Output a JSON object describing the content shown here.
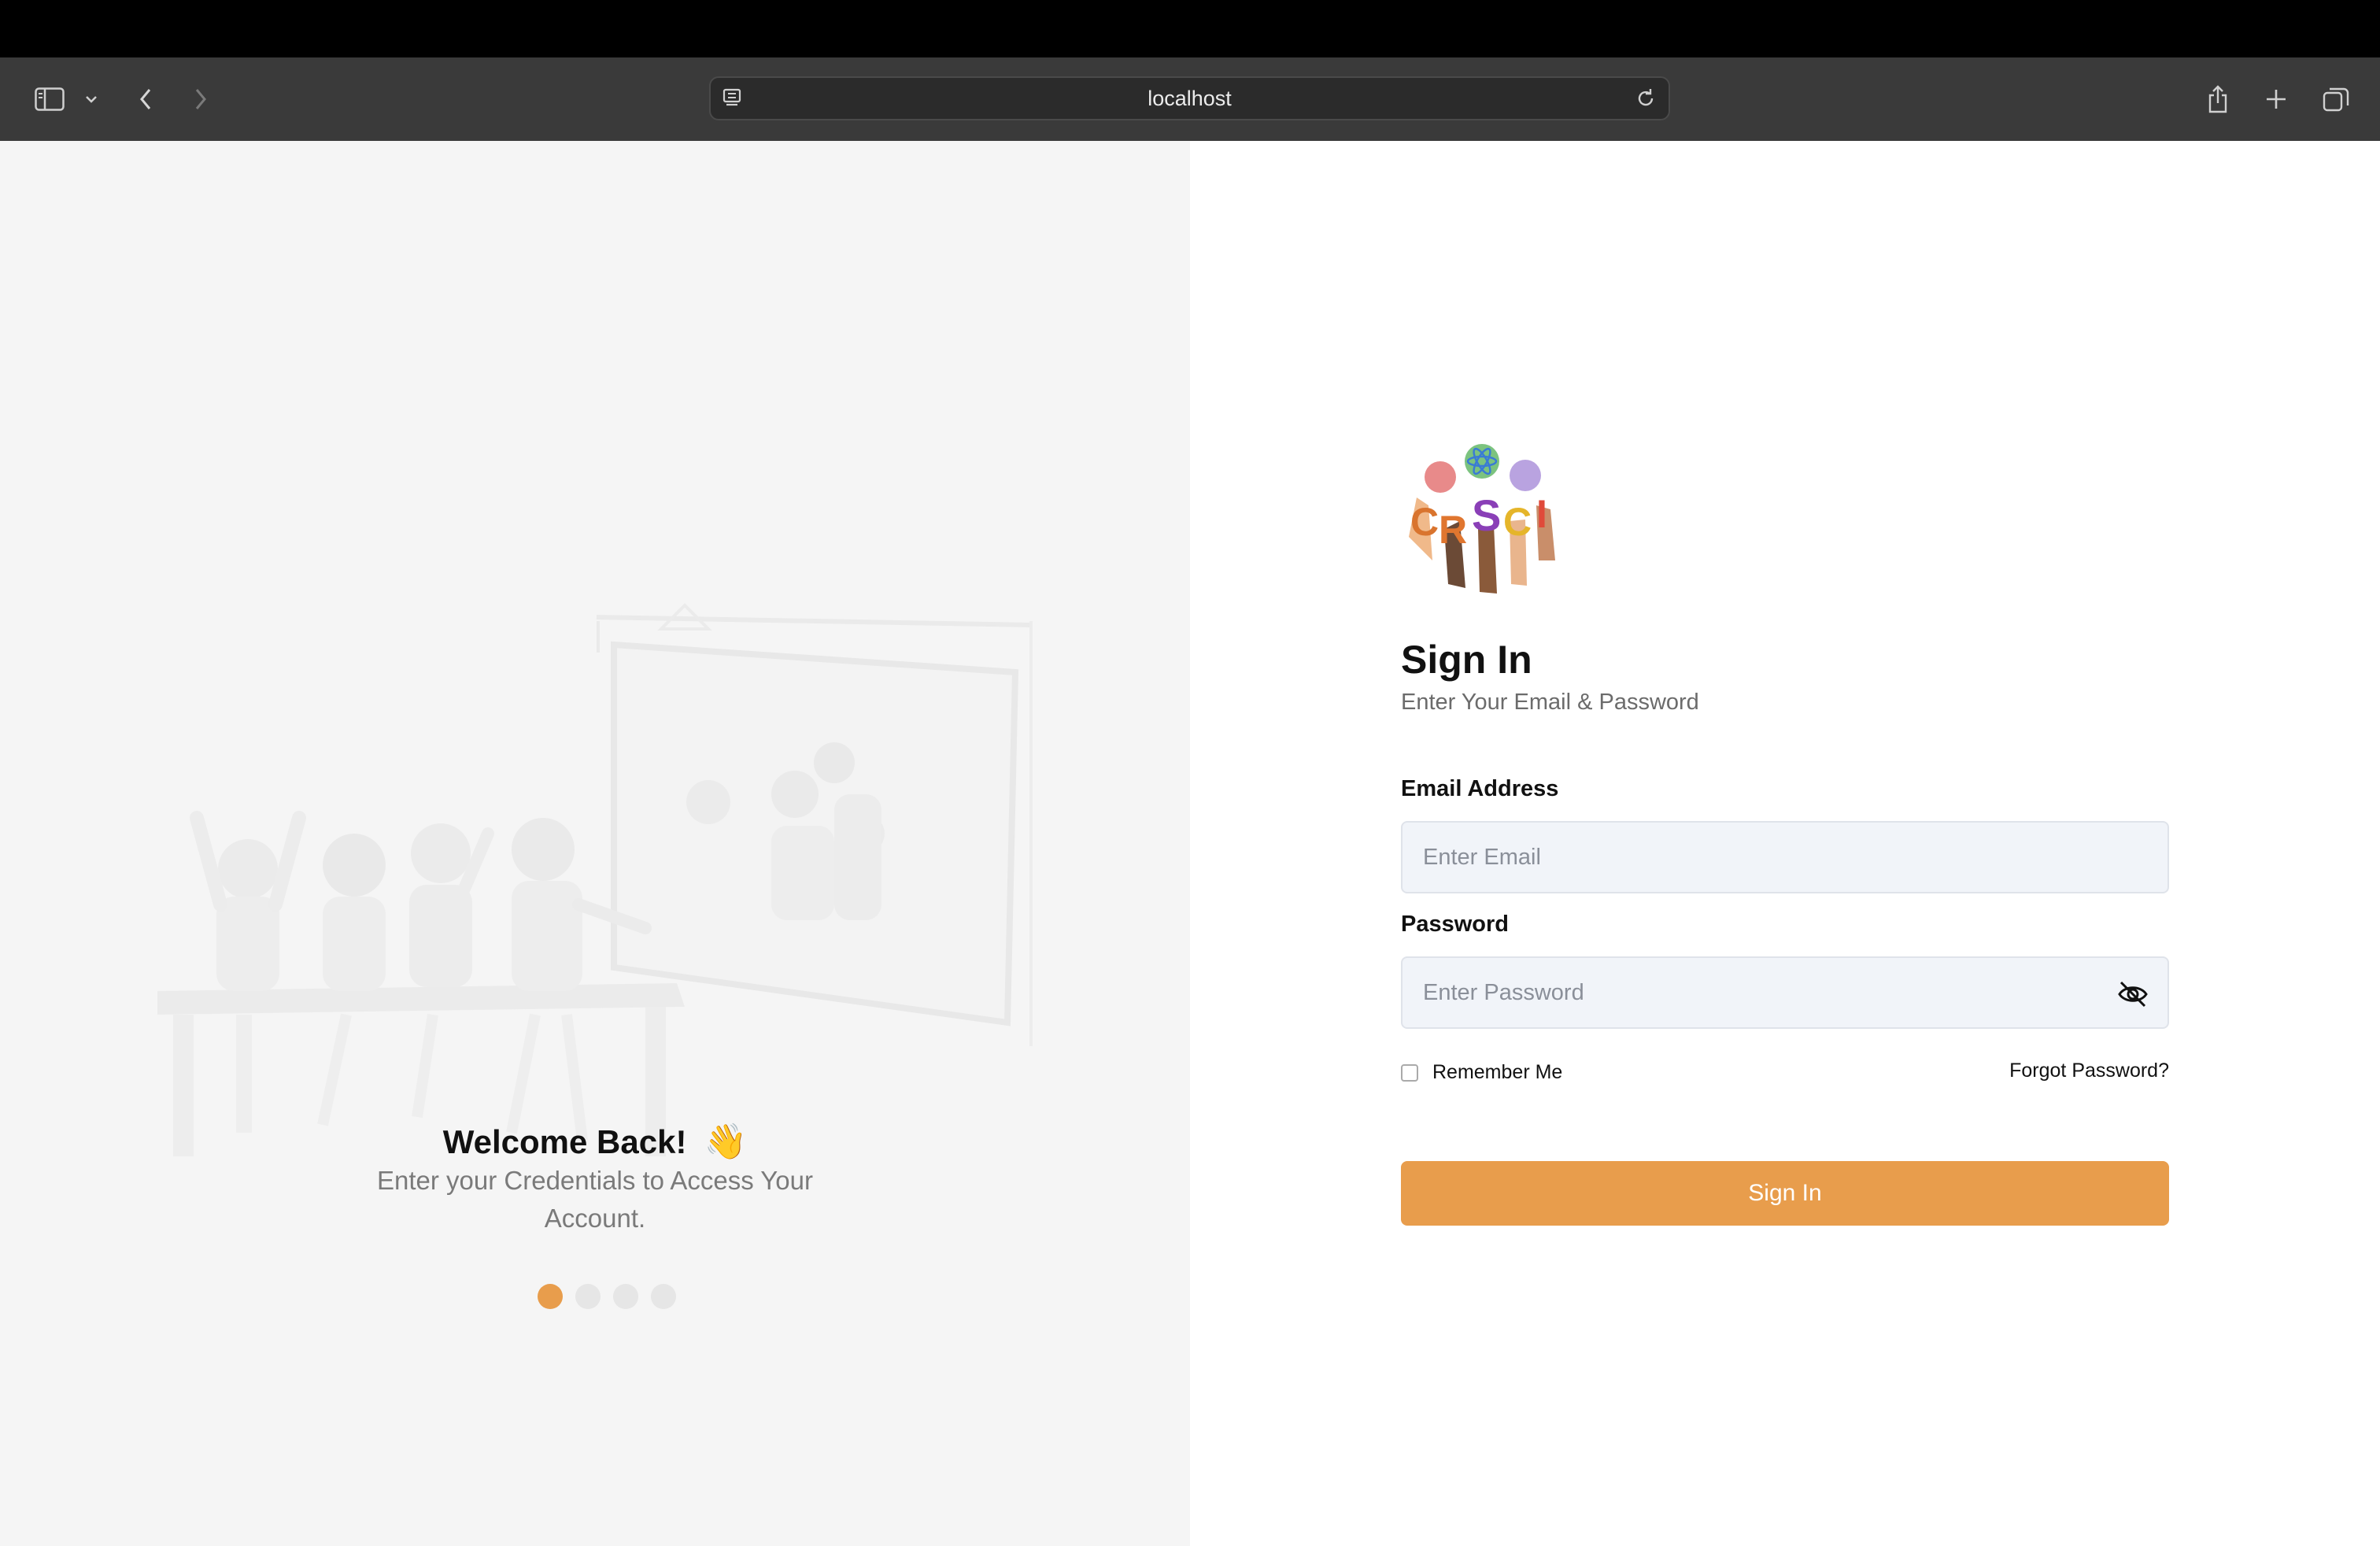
{
  "browser": {
    "url": "localhost",
    "icons": [
      "sidebar-icon",
      "chevron-down-icon",
      "back-icon",
      "forward-icon",
      "site-settings-icon",
      "reload-icon",
      "share-icon",
      "new-tab-icon",
      "tabs-overview-icon"
    ]
  },
  "left": {
    "welcome_title": "Welcome Back!",
    "wave_emoji": "👋",
    "welcome_subtitle": "Enter your Credentials to Access Your Account.",
    "carousel": {
      "total": 4,
      "active_index": 0
    }
  },
  "form": {
    "logo_letters": "CRSCI",
    "title": "Sign In",
    "subtitle": "Enter Your Email & Password",
    "email_label": "Email Address",
    "email_placeholder": "Enter Email",
    "email_value": "",
    "password_label": "Password",
    "password_placeholder": "Enter Password",
    "password_value": "",
    "remember_label": "Remember Me",
    "remember_checked": false,
    "forgot_label": "Forgot Password?",
    "submit_label": "Sign In"
  },
  "colors": {
    "accent": "#e89d4c",
    "left_bg": "#f5f5f5",
    "input_bg": "#f1f4f9"
  }
}
